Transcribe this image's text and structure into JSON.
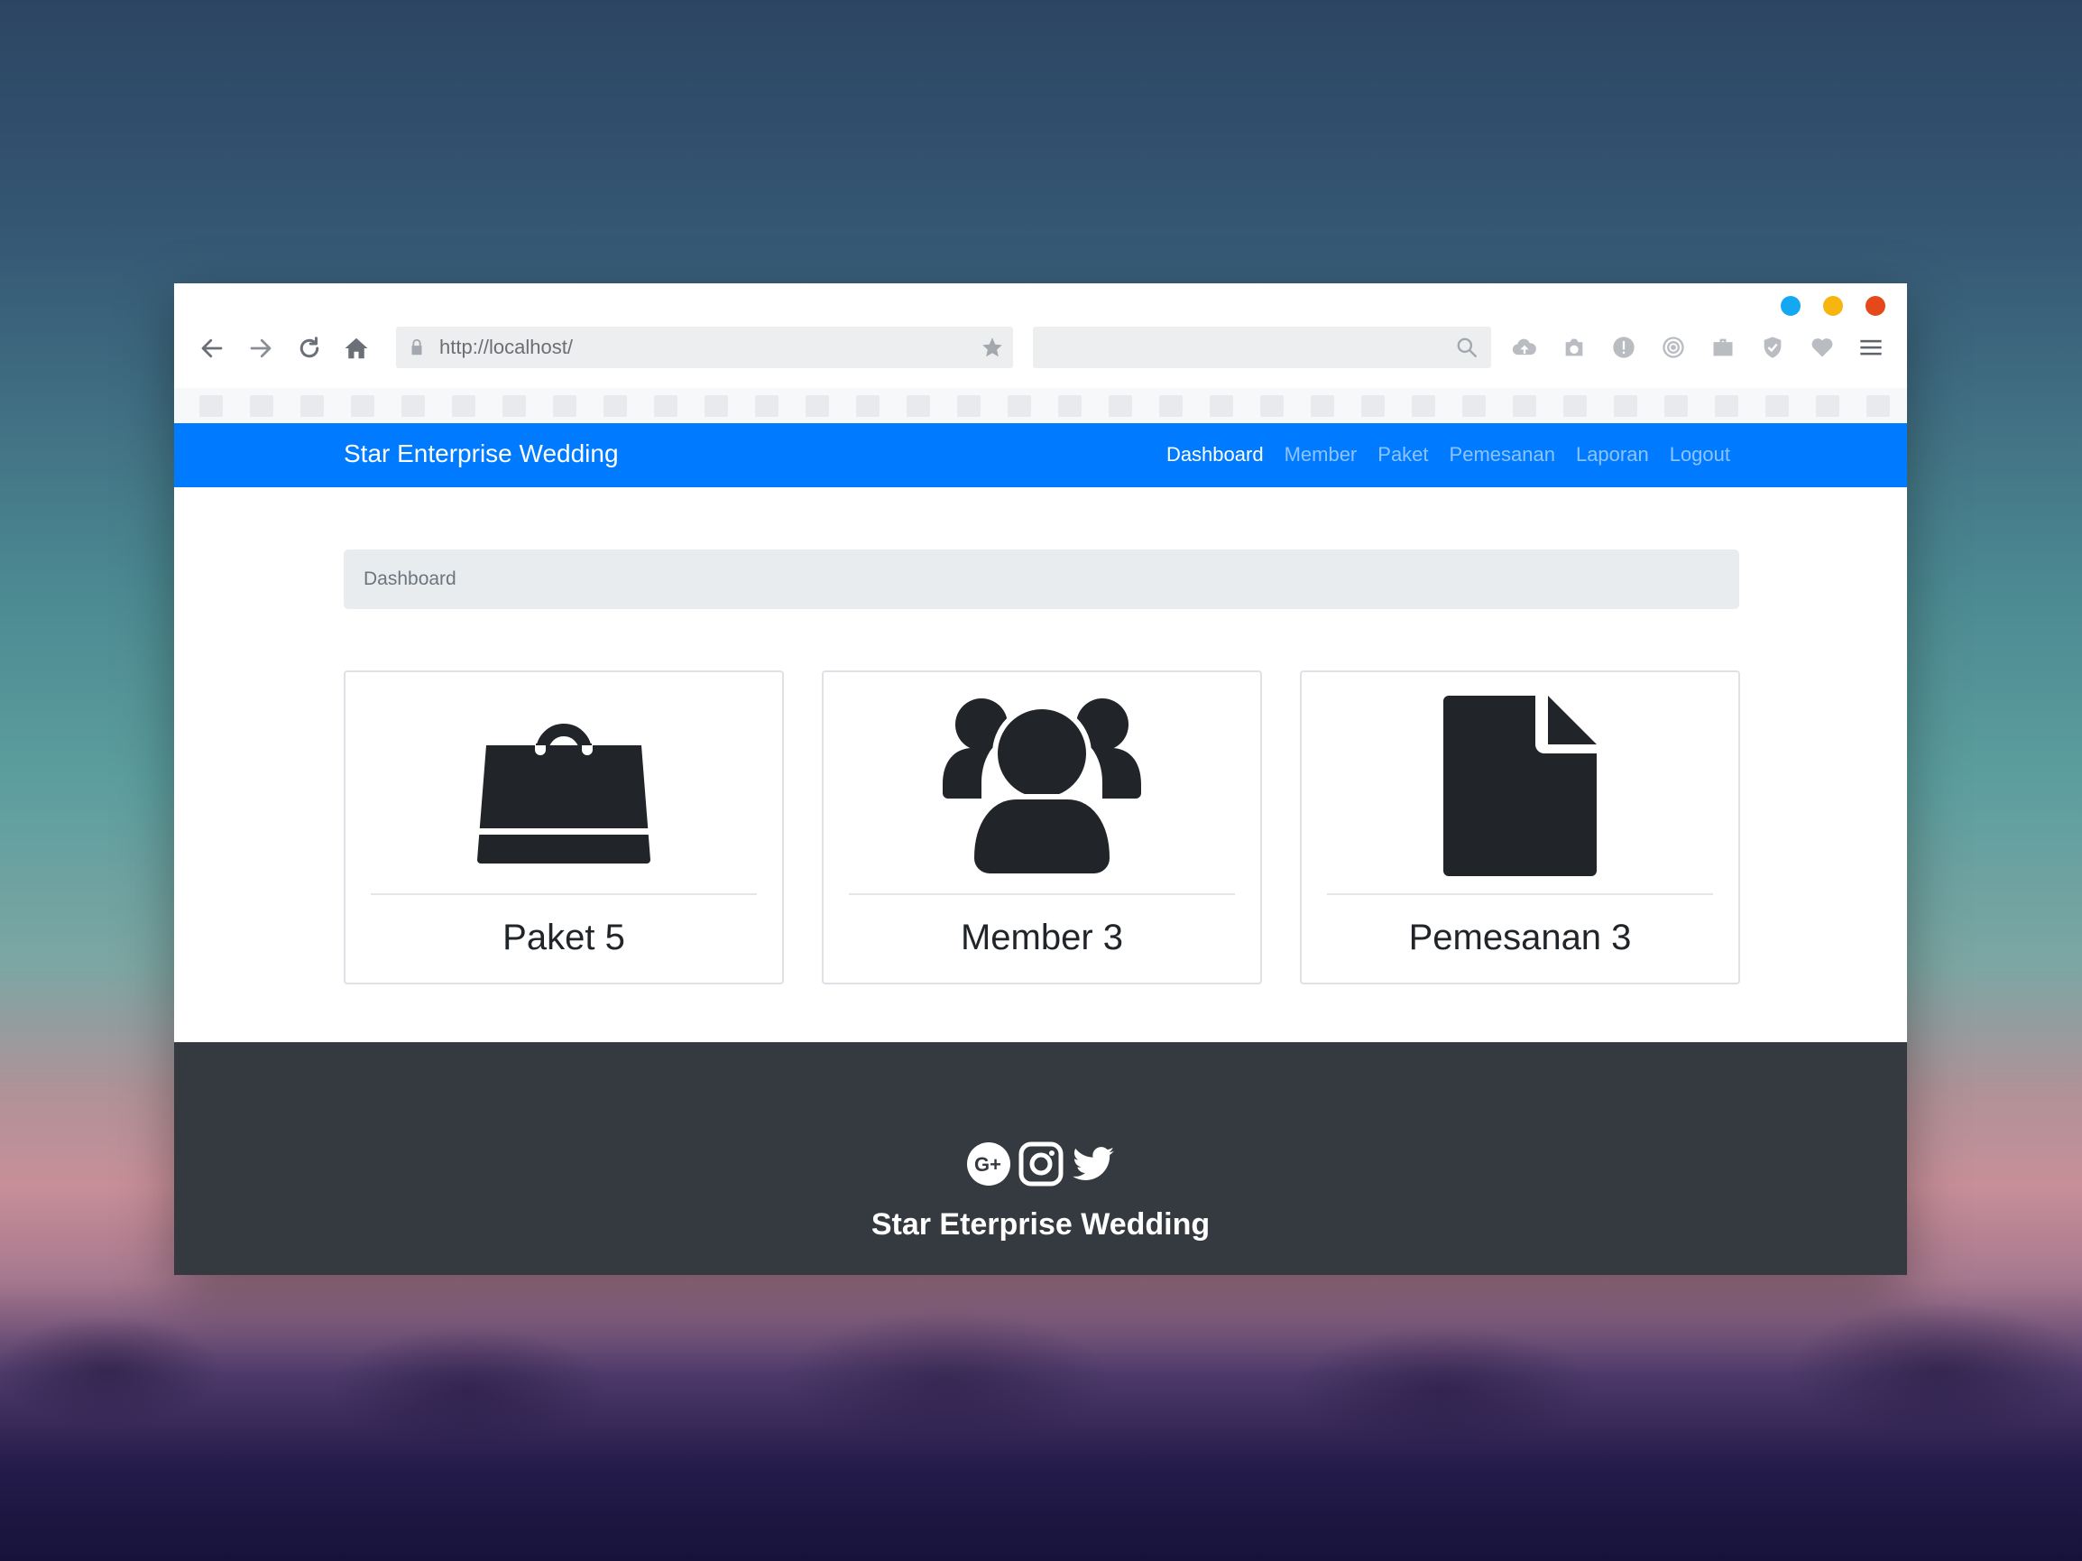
{
  "browser": {
    "url": "http://localhost/",
    "window_dot_colors": [
      "#15a8f2",
      "#f6b60f",
      "#e5481b"
    ]
  },
  "site": {
    "brand": "Star Enterprise Wedding",
    "nav": [
      {
        "label": "Dashboard",
        "active": true
      },
      {
        "label": "Member",
        "active": false
      },
      {
        "label": "Paket",
        "active": false
      },
      {
        "label": "Pemesanan",
        "active": false
      },
      {
        "label": "Laporan",
        "active": false
      },
      {
        "label": "Logout",
        "active": false
      }
    ],
    "accent": "#007bff"
  },
  "breadcrumb": "Dashboard",
  "cards": [
    {
      "icon": "shopping-bag-icon",
      "label": "Paket 5"
    },
    {
      "icon": "users-icon",
      "label": "Member 3"
    },
    {
      "icon": "file-icon",
      "label": "Pemesanan 3"
    }
  ],
  "footer": {
    "social": [
      "google-plus-icon",
      "instagram-icon",
      "twitter-icon"
    ],
    "title": "Star Eterprise Wedding"
  }
}
